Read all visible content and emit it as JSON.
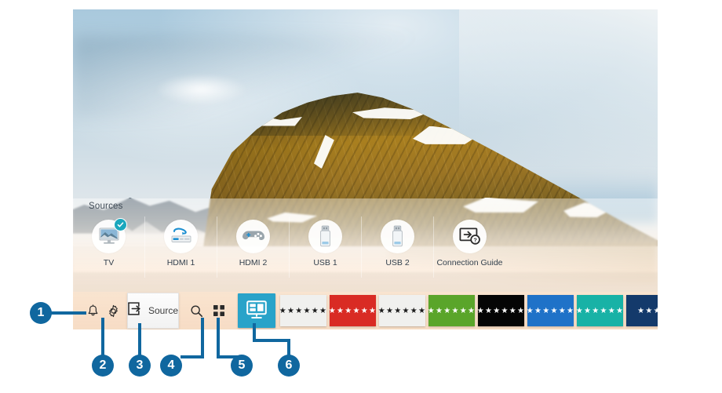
{
  "screen": {
    "background_description": "mountain-landscape-wallpaper"
  },
  "sources_panel": {
    "title": "Sources",
    "tiles": [
      {
        "label": "TV",
        "icon": "tv-icon",
        "selected": true,
        "badge": "check-badge"
      },
      {
        "label": "HDMI 1",
        "icon": "bluray-player-icon",
        "selected": false,
        "badge": ""
      },
      {
        "label": "HDMI 2",
        "icon": "game-controller-icon",
        "selected": false,
        "badge": ""
      },
      {
        "label": "USB 1",
        "icon": "usb-drive-icon",
        "selected": false,
        "badge": ""
      },
      {
        "label": "USB 2",
        "icon": "usb-drive-icon",
        "selected": false,
        "badge": ""
      },
      {
        "label": "Connection Guide",
        "icon": "connection-guide-icon",
        "selected": false,
        "badge": ""
      }
    ]
  },
  "bottom_bar": {
    "notification_icon": "bell-icon",
    "settings_icon": "gear-icon",
    "source_button": {
      "label": "Source",
      "icon": "source-input-icon"
    },
    "search_icon": "search-icon",
    "apps_icon": "apps-grid-icon",
    "tv_app_icon": "tv-home-icon",
    "app_tiles": [
      {
        "label": "★★★★★★",
        "bg": "#f0f0ee",
        "fg": "#1a1a1a"
      },
      {
        "label": "★★★★★★",
        "bg": "#d92b24",
        "fg": "#ffffff"
      },
      {
        "label": "★★★★★★",
        "bg": "#f0f0ee",
        "fg": "#1a1a1a"
      },
      {
        "label": "★★★★★★",
        "bg": "#5aa52a",
        "fg": "#ffffff"
      },
      {
        "label": "★★★★★★",
        "bg": "#050505",
        "fg": "#ffffff"
      },
      {
        "label": "★★★★★★",
        "bg": "#1f72c8",
        "fg": "#ffffff"
      },
      {
        "label": "★★★★★★",
        "bg": "#18b2a6",
        "fg": "#ffffff"
      },
      {
        "label": "★★★",
        "bg": "#143a6b",
        "fg": "#ffffff"
      }
    ],
    "tv_app_tile_bg": "#29a3c9"
  },
  "callouts": [
    {
      "number": "1"
    },
    {
      "number": "2"
    },
    {
      "number": "3"
    },
    {
      "number": "4"
    },
    {
      "number": "5"
    },
    {
      "number": "6"
    }
  ],
  "colors": {
    "callout_blue": "#10679f",
    "bar_background": "#f7dcc4",
    "accent_cyan": "#29a3c9"
  }
}
